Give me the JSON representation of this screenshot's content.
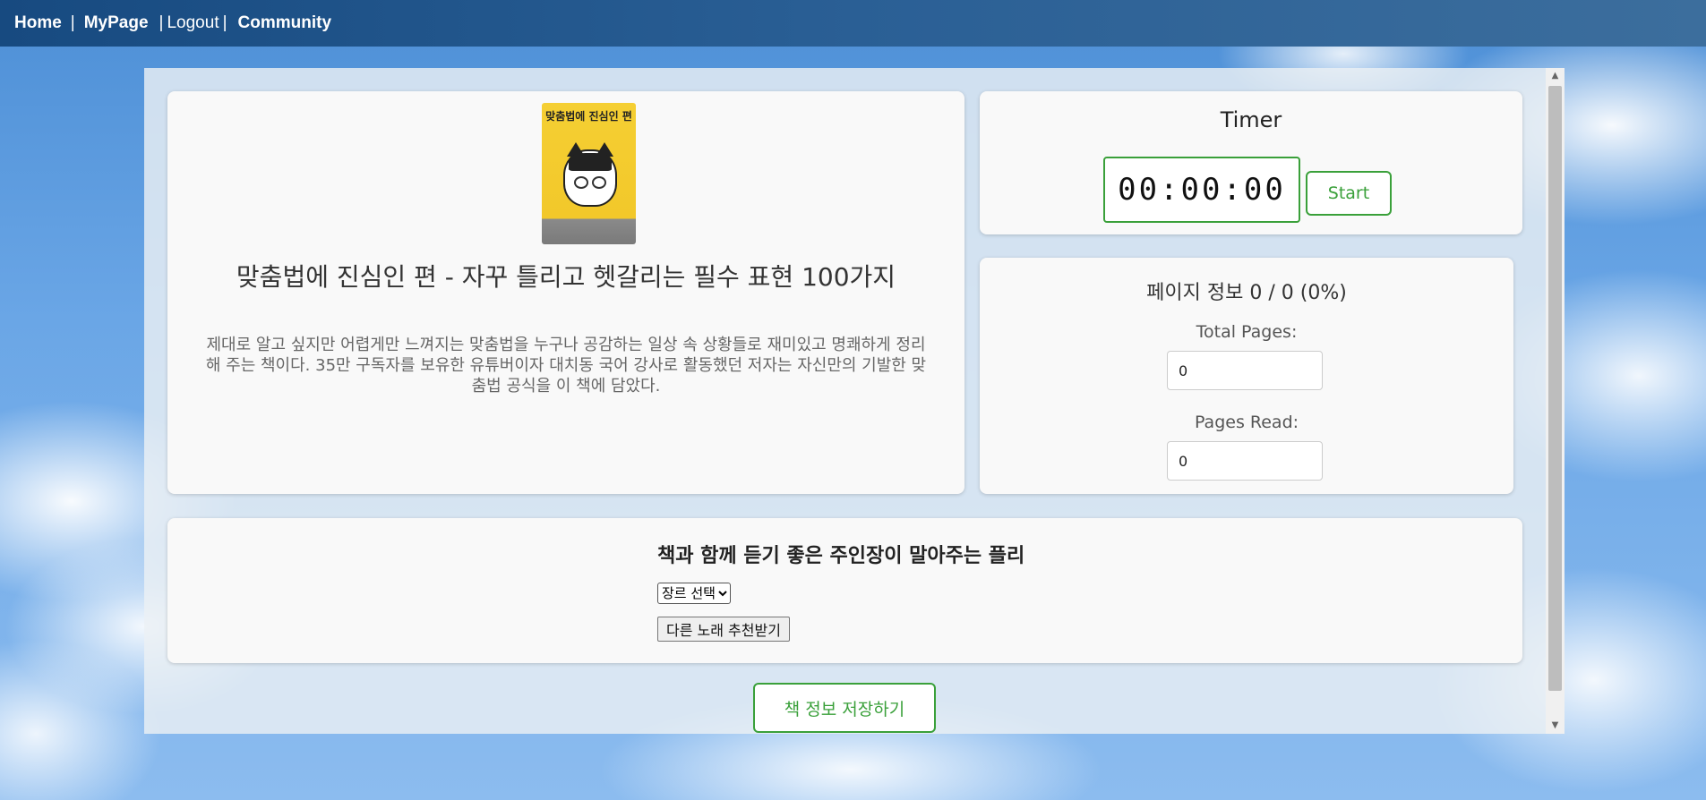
{
  "nav": {
    "home": "Home",
    "mypage": "MyPage",
    "logout": "Logout",
    "community": "Community",
    "separator": "|"
  },
  "book": {
    "cover_text": "맞춤법에 진심인 편",
    "title": "맞춤법에 진심인 편 - 자꾸 틀리고 헷갈리는 필수 표현 100가지",
    "description": "제대로 알고 싶지만 어렵게만 느껴지는 맞춤법을 누구나 공감하는 일상 속 상황들로 재미있고 명쾌하게 정리해 주는 책이다. 35만 구독자를 보유한 유튜버이자 대치동 국어 강사로 활동했던 저자는 자신만의 기발한 맞춤법 공식을 이 책에 담았다."
  },
  "timer": {
    "title": "Timer",
    "display": "00:00:00",
    "start_label": "Start"
  },
  "pages": {
    "heading": "페이지 정보 0 / 0 (0%)",
    "total_label": "Total Pages:",
    "total_value": "0",
    "read_label": "Pages Read:",
    "read_value": "0",
    "progress_percent": 0
  },
  "music": {
    "title": "책과 함께 듣기 좋은 주인장이 말아주는 플리",
    "genre_selected": "장르 선택",
    "recommend_label": "다른 노래 추천받기"
  },
  "save_label": "책 정보 저장하기",
  "colors": {
    "accent_green": "#3aa03a",
    "nav_bg": "#1f5288"
  }
}
